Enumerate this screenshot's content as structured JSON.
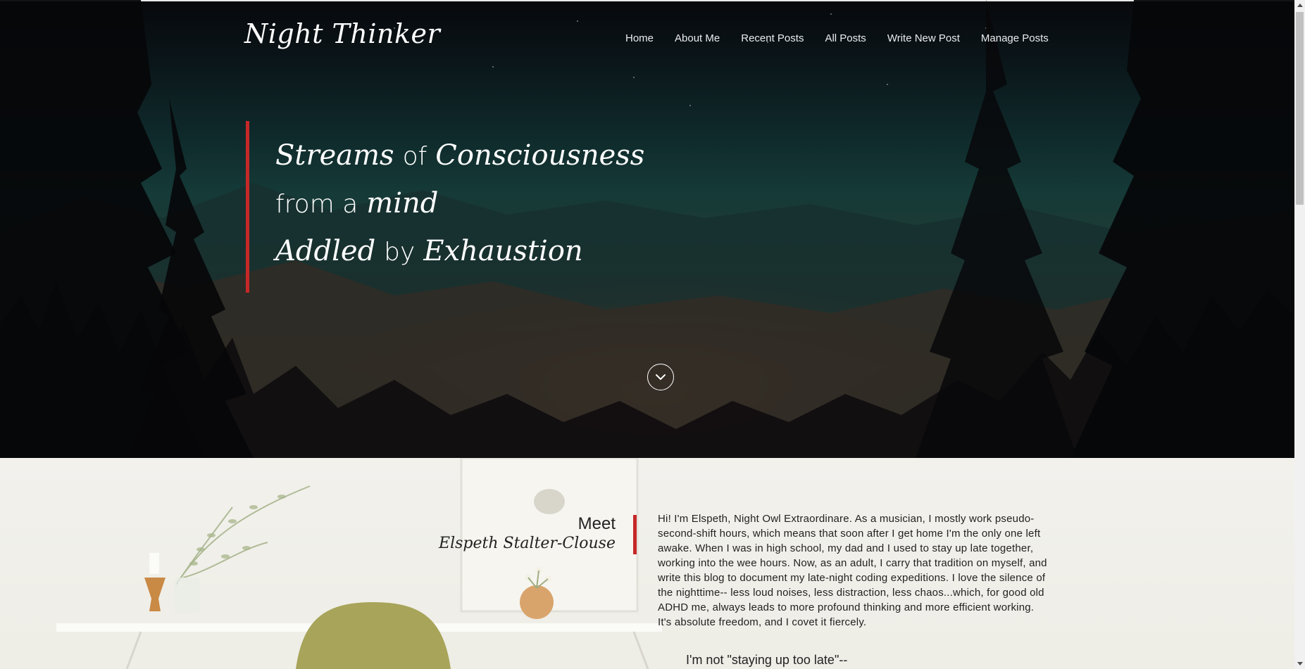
{
  "site": {
    "brand": "Night Thinker"
  },
  "nav": {
    "items": [
      {
        "label": "Home"
      },
      {
        "label": "About Me"
      },
      {
        "label": "Recent Posts"
      },
      {
        "label": "All Posts"
      },
      {
        "label": "Write New Post"
      },
      {
        "label": "Manage Posts"
      }
    ]
  },
  "hero": {
    "tagline": {
      "line1": {
        "a": "Streams",
        "b": "of",
        "c": "Consciousness"
      },
      "line2": {
        "a": "from a",
        "b": "mind"
      },
      "line3": {
        "a": "Addled",
        "b": "by",
        "c": "Exhaustion"
      }
    },
    "scroll_icon": "chevron-down-icon"
  },
  "about": {
    "meet_label": "Meet",
    "meet_name": "Elspeth Stalter-Clouse",
    "bio": "Hi! I'm Elspeth, Night Owl Extraordinare. As a musician, I mostly work pseudo-second-shift hours, which means that soon after I get home I'm the only one left awake. When I was in high school, my dad and I used to stay up late together, working into the wee hours. Now, as an adult, I carry that tradition on myself, and write this blog to document my late-night coding expeditions. I love the silence of the nighttime-- less loud noises, less distraction, less chaos...which, for good old ADHD me, always leads to more profound thinking and more efficient working. It's absolute freedom, and I covet it fiercely.",
    "quote": "I'm not \"staying up too late\"--"
  },
  "colors": {
    "accent": "#c62828",
    "hero_text": "#ffffff",
    "about_bg": "#f2f1ec"
  }
}
